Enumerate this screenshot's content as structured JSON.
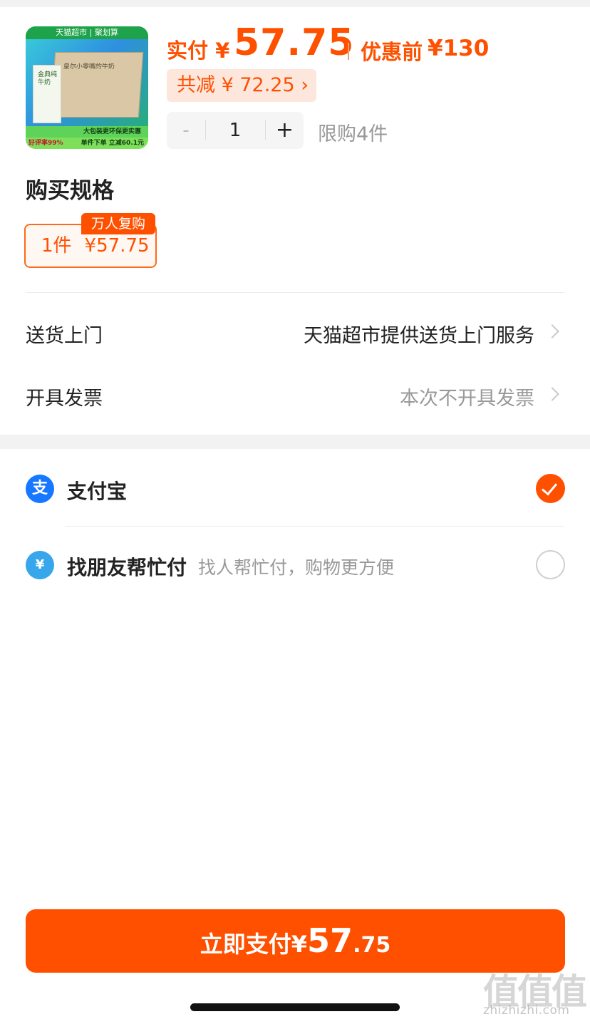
{
  "product": {
    "thumb_header": "天猫超市 | 聚划算",
    "thumb_box_label": "皇尔小零嘴的牛奶",
    "thumb_carton_text": "金典纯牛奶",
    "thumb_band": "大包装更环保更实惠",
    "thumb_rating": "好评率99%",
    "thumb_cut": "单件下单 立减60.1元"
  },
  "price": {
    "pay_label": "实付 ¥",
    "pay_amount": "57.75",
    "orig_label": "优惠前",
    "orig_amount": "¥130",
    "save_text": "共减 ¥ 72.25 ›"
  },
  "quantity": {
    "minus": "-",
    "value": "1",
    "plus": "+",
    "limit_text": "限购4件"
  },
  "spec": {
    "title": "购买规格",
    "badge": "万人复购",
    "option_count": "1件",
    "option_price": "¥57.75"
  },
  "rows": {
    "delivery_label": "送货上门",
    "delivery_value": "天猫超市提供送货上门服务",
    "invoice_label": "开具发票",
    "invoice_value": "本次不开具发票"
  },
  "payment": {
    "alipay_icon": "支",
    "alipay_name": "支付宝",
    "alipay_selected": true,
    "friend_icon": "¥",
    "friend_name": "找朋友帮忙付",
    "friend_desc": "找人帮忙付，购物更方便",
    "friend_selected": false
  },
  "button": {
    "label": "立即支付¥",
    "amount_int": "57",
    "amount_dec": ".75"
  },
  "watermark": {
    "main": "值值值",
    "sub": "zhizhizhi.com"
  },
  "colors": {
    "accent": "#ff5000",
    "alipay_blue": "#1677ff"
  }
}
